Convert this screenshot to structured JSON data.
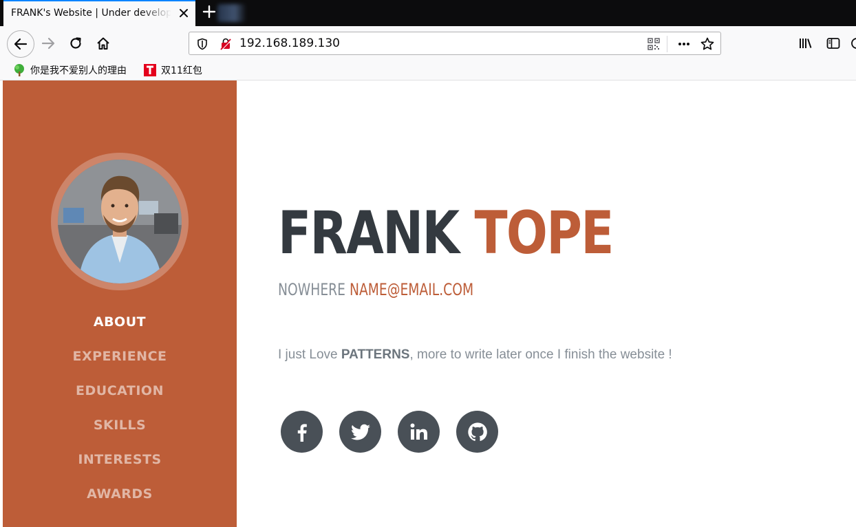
{
  "browser": {
    "tab": {
      "title": "FRANK's Website | Under development"
    },
    "url": "192.168.189.130",
    "bookmarks": [
      {
        "label": "你是我不爱别人的理由",
        "icon": "tree-icon"
      },
      {
        "label": "双11红包",
        "icon": "tmall-icon"
      }
    ]
  },
  "sidebar": {
    "nav": [
      "ABOUT",
      "EXPERIENCE",
      "EDUCATION",
      "SKILLS",
      "INTERESTS",
      "AWARDS"
    ],
    "active_index": 0,
    "color": "#bd5d38"
  },
  "hero": {
    "first_name": "FRANK",
    "last_name": "TOPE",
    "location": "NOWHERE",
    "email": "NAME@EMAIL.COM",
    "lead_before": "I just Love ",
    "lead_bold": "PATTERNS",
    "lead_after": ", more to write later once I finish the website !"
  },
  "social": [
    "facebook-icon",
    "twitter-icon",
    "linkedin-icon",
    "github-icon"
  ]
}
